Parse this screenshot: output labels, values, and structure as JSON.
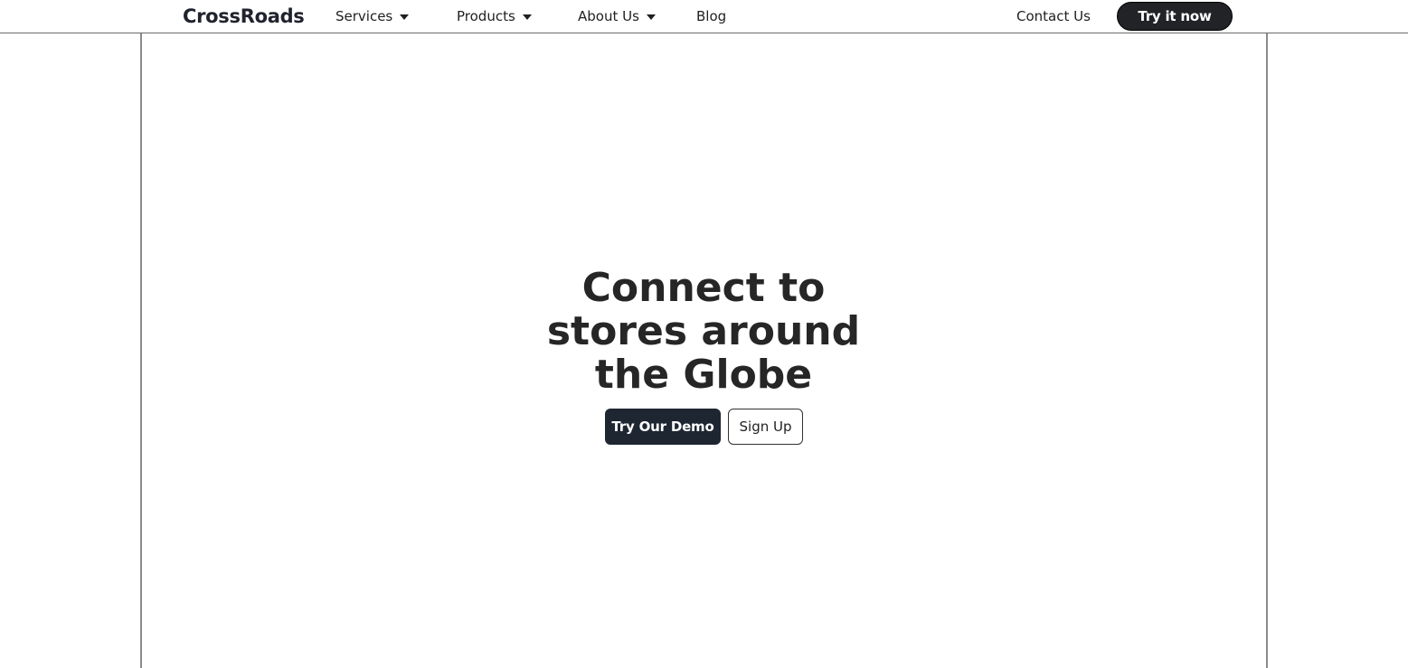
{
  "navbar": {
    "logo": "CrossRoads",
    "items": [
      {
        "label": "Services",
        "has_dropdown": true
      },
      {
        "label": "Products",
        "has_dropdown": true
      },
      {
        "label": "About Us",
        "has_dropdown": true
      },
      {
        "label": "Blog",
        "has_dropdown": false
      }
    ],
    "contact_label": "Contact Us",
    "cta_label": "Try it now"
  },
  "hero": {
    "title_lines": [
      "Connect to",
      "stores around",
      "the Globe"
    ],
    "primary_button": "Try Our Demo",
    "secondary_button": "Sign Up"
  },
  "colors": {
    "primary_dark": "#1e2632",
    "cta_dark": "#222326",
    "text": "#262626",
    "frame_border": "#8a8a8a"
  }
}
